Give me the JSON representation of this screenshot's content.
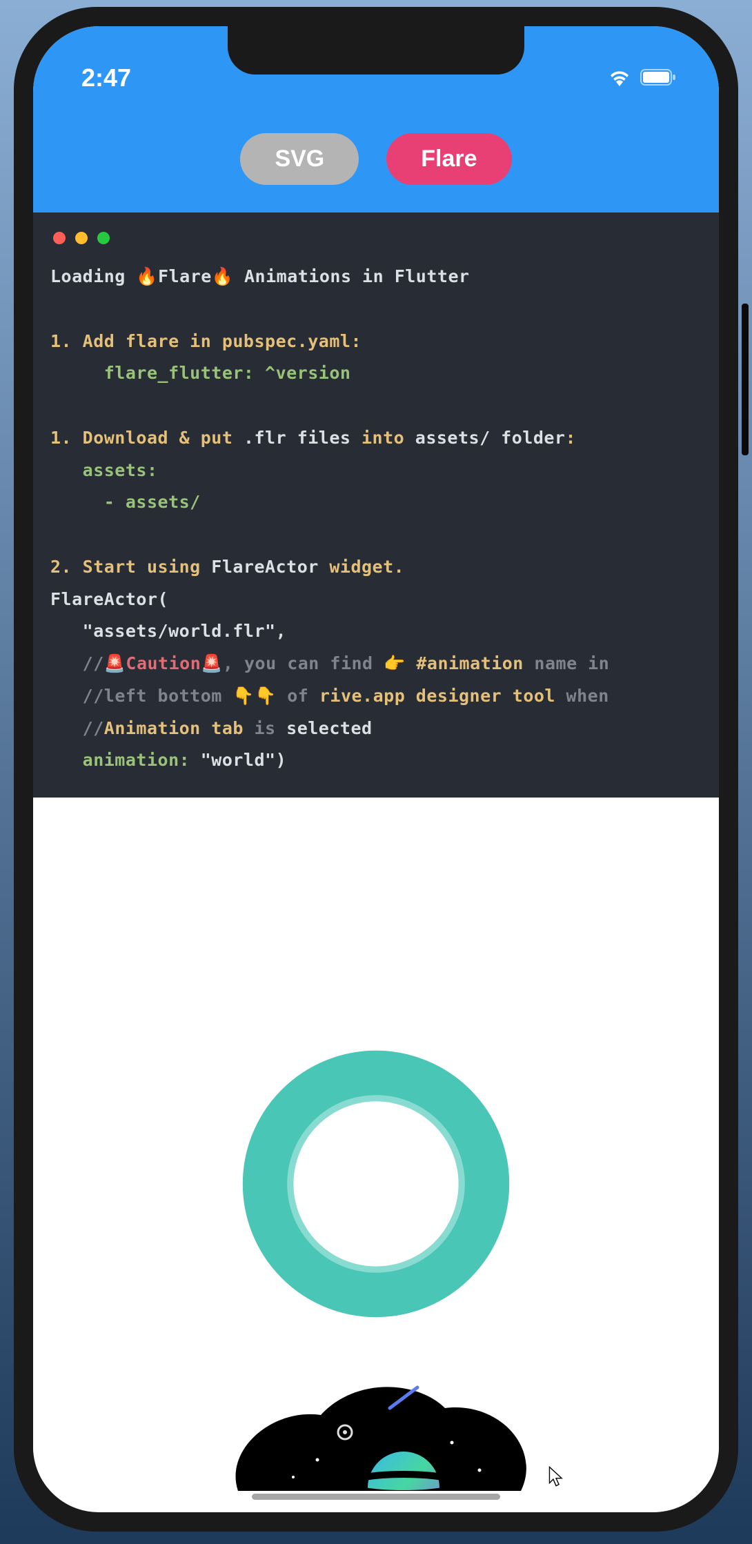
{
  "status": {
    "time": "2:47"
  },
  "tabs": {
    "svg": "SVG",
    "flare": "Flare"
  },
  "code": {
    "title_1": "Loading ",
    "title_flare": "🔥Flare🔥",
    "title_2": " Animations in Flutter",
    "step1_num": "1. ",
    "step1_txt": "Add flare in pubspec.yaml:",
    "step1_dep": "     flare_flutter: ^version",
    "step1b_num": "1. ",
    "step1b_a": "Download & put ",
    "step1b_flr": ".flr files",
    "step1b_into": " into ",
    "step1b_assets": "assets/ folder",
    "step1b_colon": ":",
    "yaml_assets": "   assets:",
    "yaml_path": "     - assets/",
    "step2_num": "2. ",
    "step2_a": "Start using ",
    "step2_b": "FlareActor",
    "step2_c": " widget.",
    "fa_open": "FlareActor(",
    "fa_path": "   \"assets/world.flr\",",
    "c1_prefix": "   //",
    "c1_caution": "🚨Caution🚨",
    "c1_mid": ", you can find 👉 ",
    "c1_anim": "#animation",
    "c1_end": " name in",
    "c2_prefix": "   //",
    "c2_a": "left bottom 👇👇 of ",
    "c2_b": "rive.app designer tool",
    "c2_c": " when",
    "c3_prefix": "   //",
    "c3_a": "Animation tab",
    "c3_b": " is ",
    "c3_c": "selected",
    "fa_anim_key": "   animation:",
    "fa_anim_val": " \"world\")"
  }
}
